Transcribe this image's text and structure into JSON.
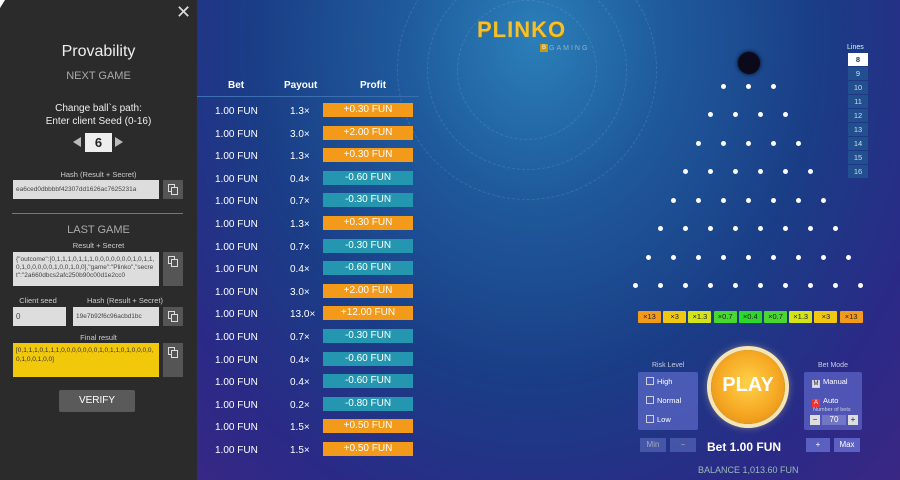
{
  "side_panel": {
    "title": "Provability",
    "next_game": "NEXT GAME",
    "change_path_line1": "Change ball`s path:",
    "change_path_line2": "Enter client Seed (0-16)",
    "seed_value": "6",
    "hash_label": "Hash (Result + Secret)",
    "hash_value": "ea6ced0dbbbbf42307dd1626ac7625231a",
    "last_game": "LAST GAME",
    "result_secret_label": "Result + Secret",
    "result_secret_value": "{\"outcome\":[0,1,1,1,0,1,1,1,0,0,0,0,0,0,0,1,0,1,1,0,1,0,0,0,0,0,1,0,0,1,0,0],\"game\":\"Plinko\",\"secret\":\"2a660dbcs2afc250b90c00d1e2cc0",
    "client_seed_label": "Client seed",
    "client_seed_value": "0",
    "hash2_label": "Hash (Result + Secret)",
    "hash2_value": "19e7b92f6c96acbd1bc",
    "final_result_label": "Final result",
    "final_result_value": "[0,1,1,1,0,1,1,1,0,0,0,0,0,0,0,1,0,1,1,0,1,0,0,0,0,0,1,0,0,1,0,0]",
    "verify_label": "VERIFY",
    "close_symbol": "✕"
  },
  "history": {
    "headers": [
      "Bet",
      "Payout",
      "Profit"
    ],
    "rows": [
      {
        "bet": "1.00 FUN",
        "payout": "1.3×",
        "profit": "+0.30 FUN",
        "positive": true
      },
      {
        "bet": "1.00 FUN",
        "payout": "3.0×",
        "profit": "+2.00 FUN",
        "positive": true
      },
      {
        "bet": "1.00 FUN",
        "payout": "1.3×",
        "profit": "+0.30 FUN",
        "positive": true
      },
      {
        "bet": "1.00 FUN",
        "payout": "0.4×",
        "profit": "-0.60 FUN",
        "positive": false
      },
      {
        "bet": "1.00 FUN",
        "payout": "0.7×",
        "profit": "-0.30 FUN",
        "positive": false
      },
      {
        "bet": "1.00 FUN",
        "payout": "1.3×",
        "profit": "+0.30 FUN",
        "positive": true
      },
      {
        "bet": "1.00 FUN",
        "payout": "0.7×",
        "profit": "-0.30 FUN",
        "positive": false
      },
      {
        "bet": "1.00 FUN",
        "payout": "0.4×",
        "profit": "-0.60 FUN",
        "positive": false
      },
      {
        "bet": "1.00 FUN",
        "payout": "3.0×",
        "profit": "+2.00 FUN",
        "positive": true
      },
      {
        "bet": "1.00 FUN",
        "payout": "13.0×",
        "profit": "+12.00 FUN",
        "positive": true
      },
      {
        "bet": "1.00 FUN",
        "payout": "0.7×",
        "profit": "-0.30 FUN",
        "positive": false
      },
      {
        "bet": "1.00 FUN",
        "payout": "0.4×",
        "profit": "-0.60 FUN",
        "positive": false
      },
      {
        "bet": "1.00 FUN",
        "payout": "0.4×",
        "profit": "-0.60 FUN",
        "positive": false
      },
      {
        "bet": "1.00 FUN",
        "payout": "0.2×",
        "profit": "-0.80 FUN",
        "positive": false
      },
      {
        "bet": "1.00 FUN",
        "payout": "1.5×",
        "profit": "+0.50 FUN",
        "positive": true
      },
      {
        "bet": "1.00 FUN",
        "payout": "1.5×",
        "profit": "+0.50 FUN",
        "positive": true
      }
    ]
  },
  "game": {
    "logo": "PLINKO",
    "logo_sub": "GAMING",
    "logo_badge": "B",
    "lines_label": "Lines",
    "lines": [
      "8",
      "9",
      "10",
      "11",
      "12",
      "13",
      "14",
      "15",
      "16"
    ],
    "selected_lines": "8",
    "multipliers": [
      {
        "label": "×13",
        "color": "#f39a1b"
      },
      {
        "label": "×3",
        "color": "#f0c814"
      },
      {
        "label": "×1.3",
        "color": "#d4e41a"
      },
      {
        "label": "×0.7",
        "color": "#48d830"
      },
      {
        "label": "×0.4",
        "color": "#2bd82b"
      },
      {
        "label": "×0.7",
        "color": "#48d830"
      },
      {
        "label": "×1.3",
        "color": "#d4e41a"
      },
      {
        "label": "×3",
        "color": "#f0c814"
      },
      {
        "label": "×13",
        "color": "#f39a1b"
      }
    ],
    "pegs_rows": 8
  },
  "controls": {
    "risk_level_label": "Risk Level",
    "risk_options": [
      "High",
      "Normal",
      "Low"
    ],
    "min_label": "Min",
    "minus_label": "−",
    "play_label": "PLAY",
    "bet_label": "Bet 1.00 FUN",
    "bet_mode_label": "Bet Mode",
    "manual_label": "Manual",
    "manual_key": "M",
    "auto_label": "Auto",
    "auto_key": "A",
    "number_of_bets_label": "Number of bets",
    "bets_value": "70",
    "plus_label": "+",
    "max_label": "Max",
    "balance": "BALANCE 1,013.60 FUN"
  }
}
